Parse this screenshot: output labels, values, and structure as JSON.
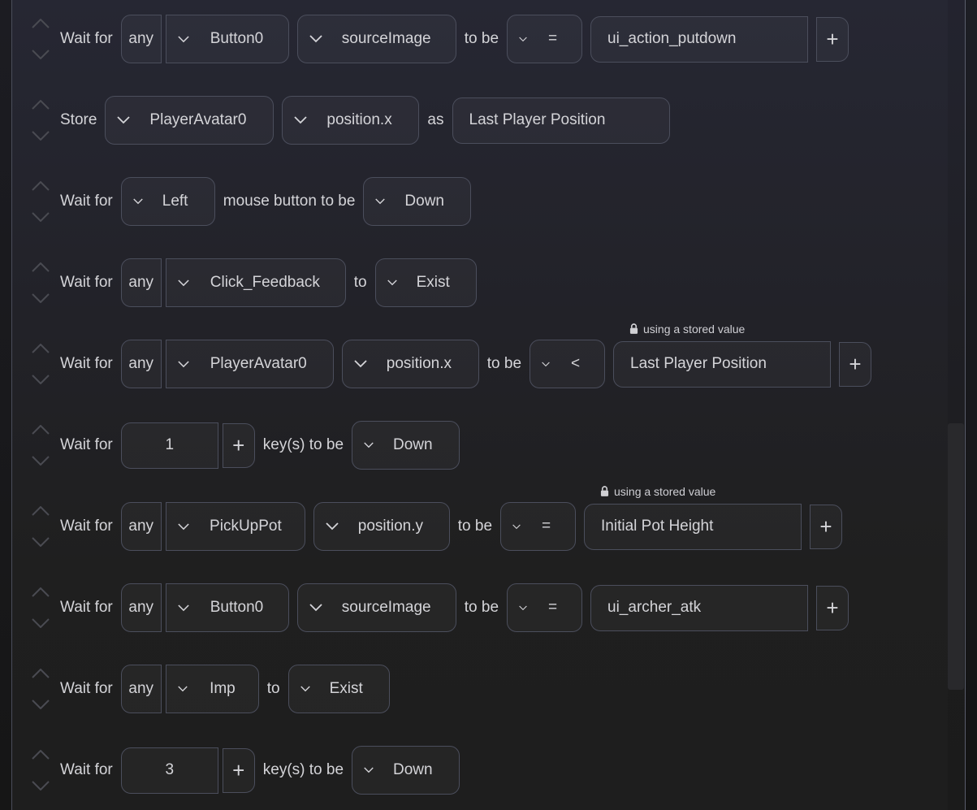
{
  "colors": {
    "panel_top": "#262733",
    "panel_bottom": "#1e1e1e",
    "border": "#4b4e5c",
    "text": "#d4d4d8",
    "reorder_arrow": "#4a4b52"
  },
  "icons": {
    "move_up": "chevron-up-icon",
    "move_down": "chevron-down-icon",
    "dropdown": "chevron-down-icon",
    "add": "plus-icon",
    "lock": "lock-icon"
  },
  "steps": [
    {
      "type": "wait_for_property",
      "label": "Wait for",
      "quantifier": "any",
      "object": "Button0",
      "property": "sourceImage",
      "connector": "to be",
      "operator": "=",
      "value": "ui_action_putdown",
      "add_label": "+"
    },
    {
      "type": "store",
      "label": "Store",
      "object": "PlayerAvatar0",
      "property": "position.x",
      "connector": "as",
      "value": "Last Player Position"
    },
    {
      "type": "wait_for_mouse",
      "label": "Wait for",
      "button": "Left",
      "connector": "mouse button to be",
      "state": "Down"
    },
    {
      "type": "wait_for_exist",
      "label": "Wait for",
      "quantifier": "any",
      "object": "Click_Feedback",
      "connector": "to",
      "state": "Exist"
    },
    {
      "type": "wait_for_property",
      "label": "Wait for",
      "quantifier": "any",
      "object": "PlayerAvatar0",
      "property": "position.x",
      "connector": "to be",
      "operator": "<",
      "value": "Last Player Position",
      "stored_note": "using a stored value",
      "add_label": "+"
    },
    {
      "type": "wait_for_key",
      "label": "Wait for",
      "key": "1",
      "add_label": "+",
      "connector": "key(s) to be",
      "state": "Down"
    },
    {
      "type": "wait_for_property",
      "label": "Wait for",
      "quantifier": "any",
      "object": "PickUpPot",
      "property": "position.y",
      "connector": "to be",
      "operator": "=",
      "value": "Initial Pot Height",
      "stored_note": "using a stored value",
      "add_label": "+"
    },
    {
      "type": "wait_for_property",
      "label": "Wait for",
      "quantifier": "any",
      "object": "Button0",
      "property": "sourceImage",
      "connector": "to be",
      "operator": "=",
      "value": "ui_archer_atk",
      "add_label": "+"
    },
    {
      "type": "wait_for_exist",
      "label": "Wait for",
      "quantifier": "any",
      "object": "Imp",
      "connector": "to",
      "state": "Exist"
    },
    {
      "type": "wait_for_key",
      "label": "Wait for",
      "key": "3",
      "add_label": "+",
      "connector": "key(s) to be",
      "state": "Down"
    }
  ]
}
